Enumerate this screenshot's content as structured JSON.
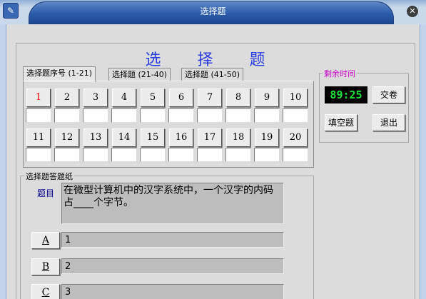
{
  "window": {
    "title": "选择题",
    "close_glyph": "✕",
    "app_glyph": "✎"
  },
  "heading": "选 择 题",
  "tabs": [
    {
      "label": "选择题序号 (1-21)",
      "active": true
    },
    {
      "label": "选择题 (21-40)",
      "active": false
    },
    {
      "label": "选择题 (41-50)",
      "active": false
    }
  ],
  "questions": {
    "row1": [
      "1",
      "2",
      "3",
      "4",
      "5",
      "6",
      "7",
      "8",
      "9",
      "10"
    ],
    "row2": [
      "11",
      "12",
      "13",
      "14",
      "15",
      "16",
      "17",
      "18",
      "19",
      "20"
    ],
    "current": "1"
  },
  "timer_group": {
    "label": "剩余时间",
    "time": "89:25",
    "submit_label": "交卷",
    "fill_blank_label": "填空题",
    "exit_label": "退出"
  },
  "answer_sheet": {
    "label": "选择题答题纸",
    "question_label": "题目",
    "question_text": "在微型计算机中的汉字系统中，一个汉字的内码占____个字节。",
    "options": [
      {
        "key": "A",
        "text": "1"
      },
      {
        "key": "B",
        "text": "2"
      },
      {
        "key": "C",
        "text": "3"
      }
    ]
  },
  "colors": {
    "heading": "#2b3fe0",
    "current_question": "#e00000",
    "timer_text": "#1ee03a",
    "group_label": "#cc00cc"
  }
}
